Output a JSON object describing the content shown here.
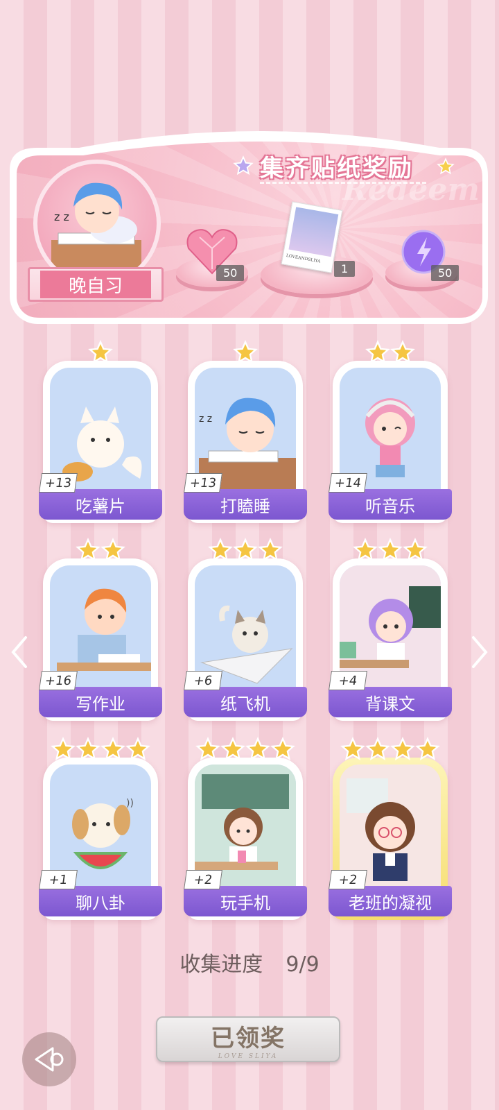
{
  "banner": {
    "title": "集齐贴纸奖励",
    "watermark": "Redeem",
    "portrait_label": "晚自习",
    "rewards": [
      {
        "icon": "heart-gem-icon",
        "count": "50"
      },
      {
        "icon": "photo-card-icon",
        "count": "1",
        "photo_caption": "LOVEANDSLIYA"
      },
      {
        "icon": "energy-orb-icon",
        "count": "50"
      }
    ]
  },
  "stickers": [
    {
      "name": "吃薯片",
      "plus": "+13",
      "stars": 1,
      "art": "fox"
    },
    {
      "name": "打瞌睡",
      "plus": "+13",
      "stars": 1,
      "art": "sleep"
    },
    {
      "name": "听音乐",
      "plus": "+14",
      "stars": 2,
      "art": "music"
    },
    {
      "name": "写作业",
      "plus": "+16",
      "stars": 2,
      "art": "homework"
    },
    {
      "name": "纸飞机",
      "plus": "+6",
      "stars": 3,
      "art": "cat-plane"
    },
    {
      "name": "背课文",
      "plus": "+4",
      "stars": 3,
      "art": "recite"
    },
    {
      "name": "聊八卦",
      "plus": "+1",
      "stars": 4,
      "art": "puppy"
    },
    {
      "name": "玩手机",
      "plus": "+2",
      "stars": 4,
      "art": "phone"
    },
    {
      "name": "老班的凝视",
      "plus": "+2",
      "stars": 4,
      "art": "teacher"
    }
  ],
  "progress": {
    "label": "收集进度",
    "value": "9/9"
  },
  "claim_button": {
    "label": "已领奖",
    "sub": "LOVE SLIYA"
  },
  "colors": {
    "accent_purple": "#8a63d8",
    "banner_pink": "#f2adbd",
    "star_gold": "#f5c542"
  }
}
